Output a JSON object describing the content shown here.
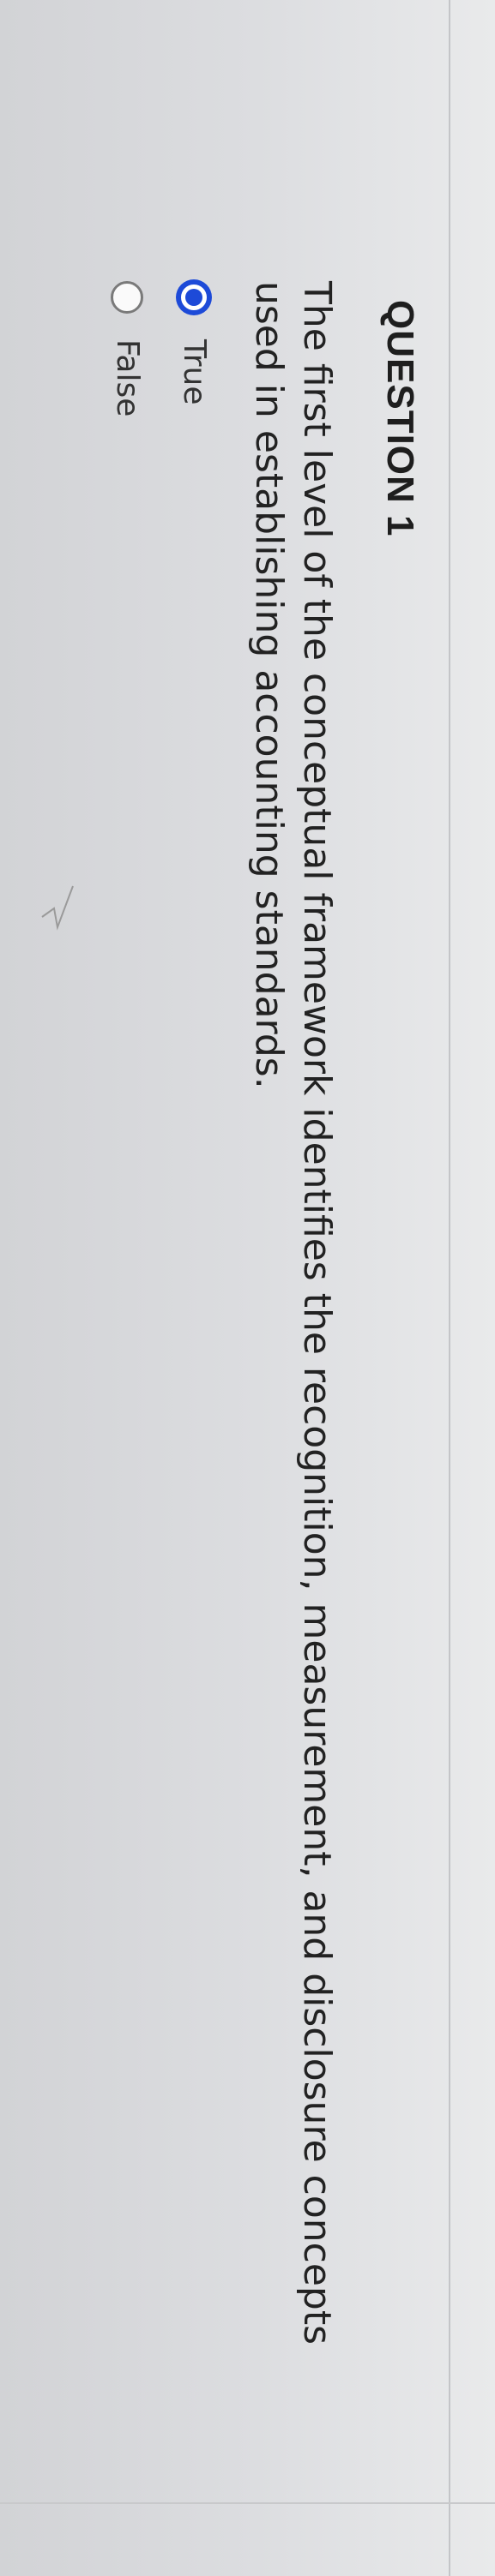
{
  "question": {
    "title": "QUESTION 1",
    "text": "The first level of the conceptual framework identifies the recognition, measurement, and disclosure concepts used in establishing accounting standards."
  },
  "options": [
    {
      "label": "True",
      "selected": true
    },
    {
      "label": "False",
      "selected": false
    }
  ],
  "colors": {
    "accent": "#1d4ad8",
    "background": "#e2e3e5"
  }
}
